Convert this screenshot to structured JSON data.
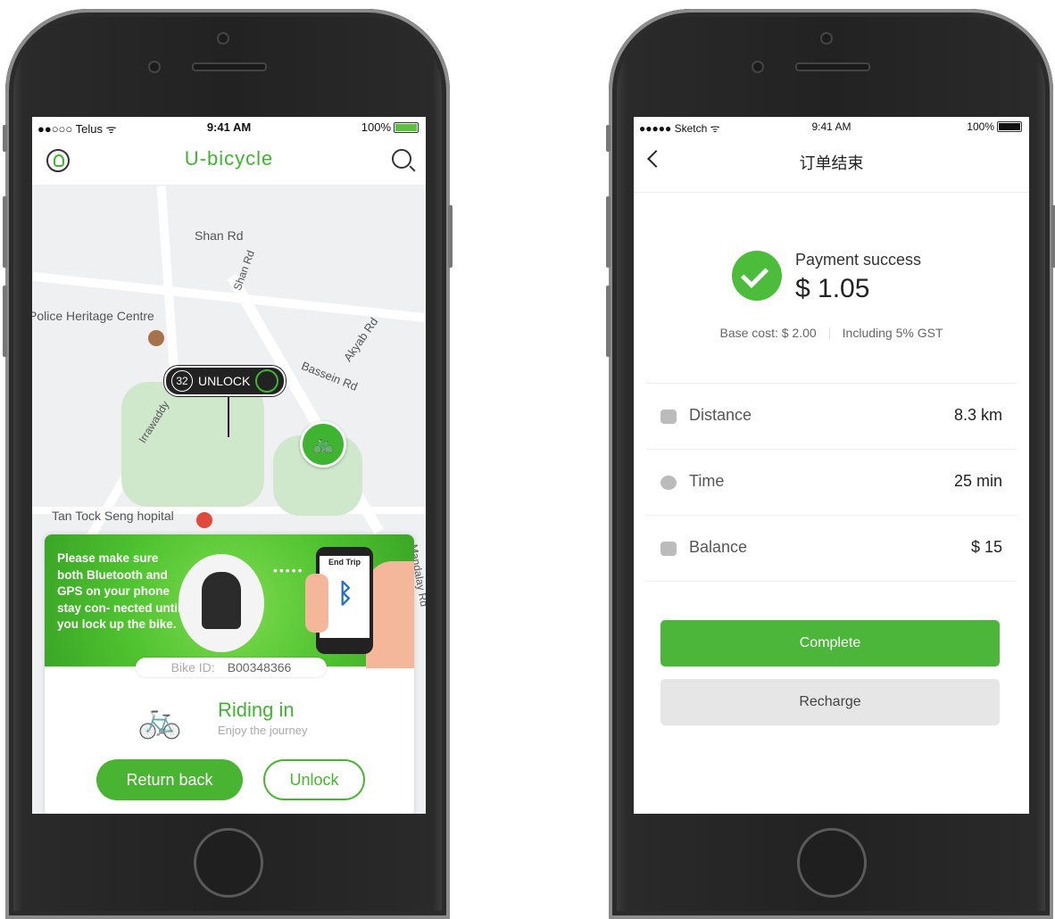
{
  "left_phone": {
    "status": {
      "carrier": "●●○○○ Telus ᯤ",
      "time": "9:41 AM",
      "battery": "100%"
    },
    "header": {
      "title": "U-bicycle"
    },
    "map": {
      "labels": [
        "Shan Rd",
        "Shan Rd",
        "Police Heritage Centre",
        "Akyab Rd",
        "Bassein Rd",
        "Irrawaddy",
        "Tan Tock Seng hopital",
        "Mandalay Rd"
      ],
      "marker": {
        "count": "32",
        "label": "UNLOCK"
      }
    },
    "card": {
      "notice": "Please make sure both Bluetooth and GPS on your phone stay con- nected until you lock up the bike.",
      "phone_screen_label": "End Trip",
      "bike_id_label": "Bike ID:",
      "bike_id": "B00348366",
      "status_title": "Riding in",
      "status_sub": "Enjoy the journey",
      "return_button": "Return back",
      "unlock_button": "Unlock"
    }
  },
  "right_phone": {
    "status": {
      "carrier": "●●●●● Sketch ᯤ",
      "time": "9:41 AM",
      "battery": "100%"
    },
    "header": {
      "title": "订单结束"
    },
    "payment": {
      "title": "Payment success",
      "amount": "$ 1.05",
      "base_cost": "Base cost: $ 2.00",
      "tax_note": "Including 5% GST"
    },
    "rows": [
      {
        "label": "Distance",
        "value": "8.3 km"
      },
      {
        "label": "Time",
        "value": "25 min"
      },
      {
        "label": "Balance",
        "value": "$ 15"
      }
    ],
    "complete_button": "Complete",
    "recharge_button": "Recharge"
  },
  "colors": {
    "accent": "#4cb63a",
    "map_bg": "#eef0f2"
  }
}
